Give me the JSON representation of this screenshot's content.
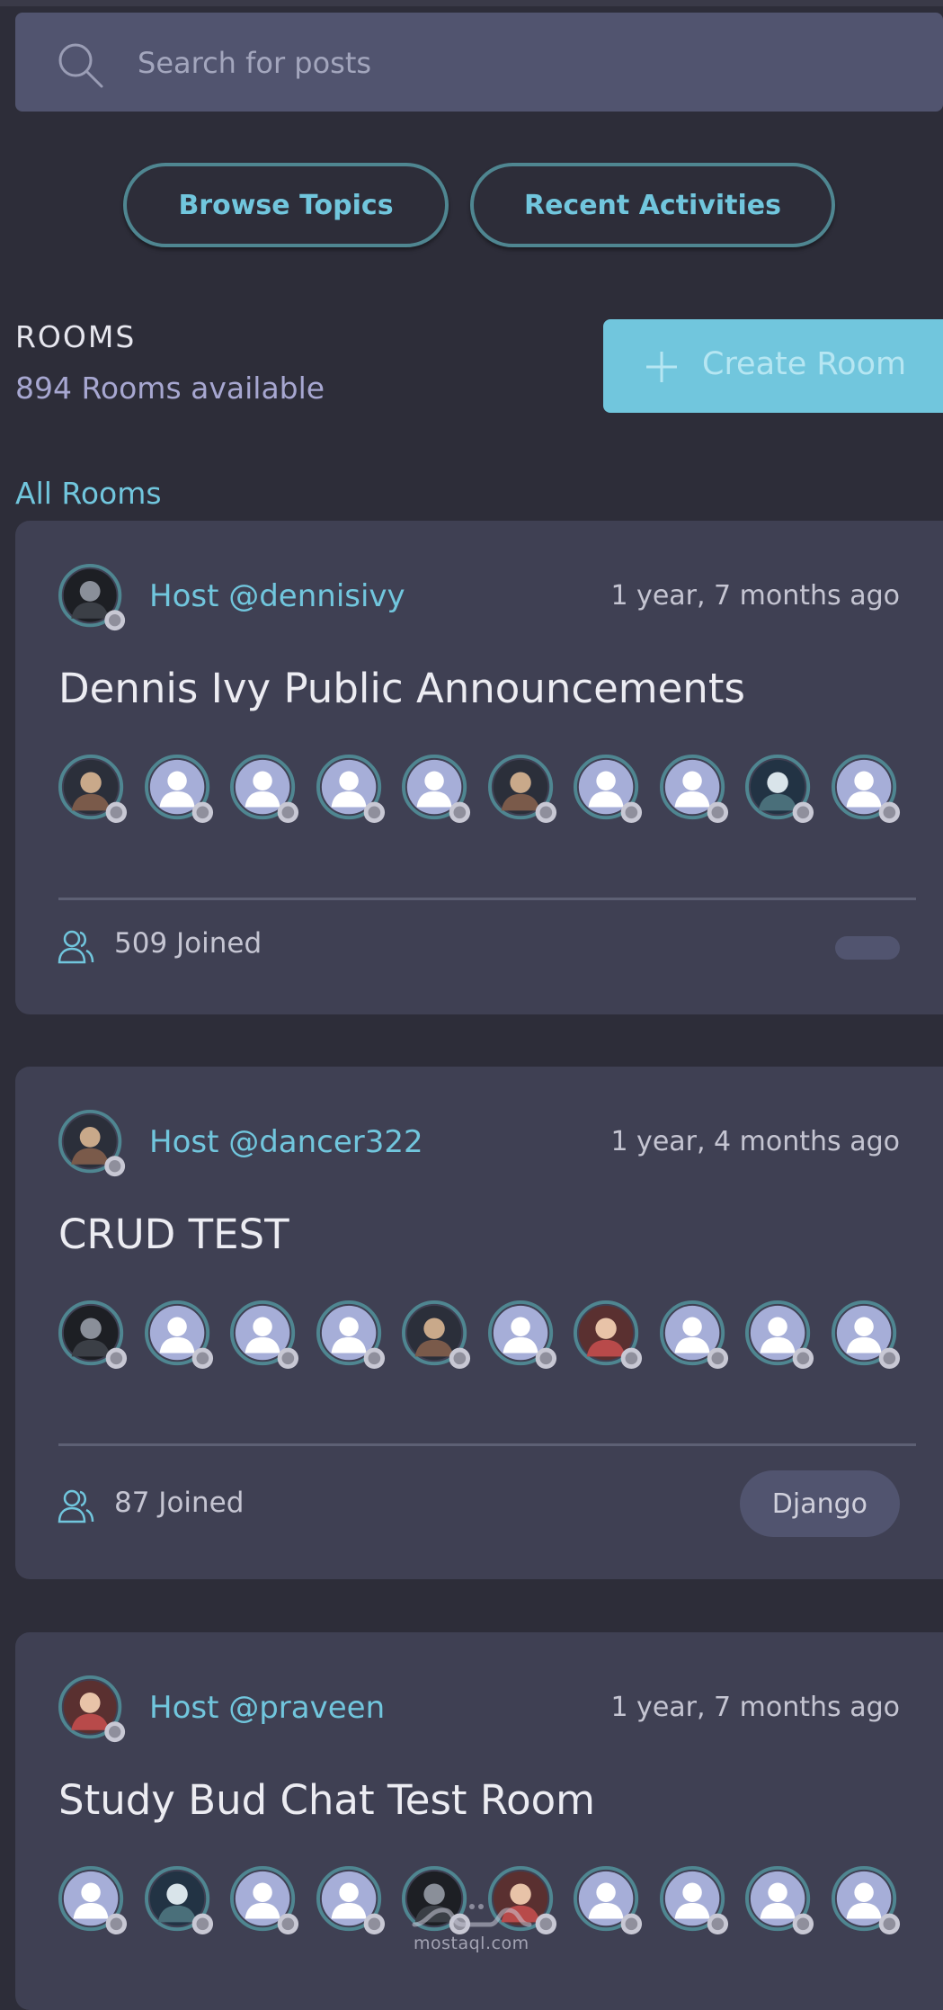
{
  "search": {
    "placeholder": "Search for posts",
    "value": ""
  },
  "nav": {
    "browse_label": "Browse Topics",
    "recent_label": "Recent Activities"
  },
  "rooms_header": {
    "title": "ROOMS",
    "count_text": "894 Rooms available",
    "create_label": "Create Room",
    "filter_label": "All Rooms"
  },
  "colors": {
    "accent": "#71c6dd",
    "background": "#2d2d39",
    "card": "#3f4053",
    "search_bg": "#51546f",
    "muted_text": "#a7a7d1"
  },
  "rooms": [
    {
      "host": "Host @dennisivy",
      "time": "1 year, 7 months ago",
      "title": "Dennis Ivy Public Announcements",
      "participants": [
        "photo",
        "default",
        "default",
        "default",
        "default",
        "photo",
        "default",
        "default",
        "photo",
        "default"
      ],
      "joined": "509 Joined",
      "topic": ""
    },
    {
      "host": "Host @dancer322",
      "time": "1 year, 4 months ago",
      "title": "CRUD TEST",
      "participants": [
        "photo",
        "default",
        "default",
        "default",
        "photo",
        "default",
        "photo",
        "default",
        "default",
        "default"
      ],
      "joined": "87 Joined",
      "topic": "Django"
    },
    {
      "host": "Host @praveen",
      "time": "1 year, 7 months ago",
      "title": "Study Bud Chat Test Room",
      "participants": [
        "default",
        "photo",
        "default",
        "default",
        "photo",
        "photo",
        "default",
        "default",
        "default",
        "default"
      ],
      "joined": "",
      "topic": ""
    }
  ],
  "watermark": {
    "text": "mostaql.com"
  }
}
